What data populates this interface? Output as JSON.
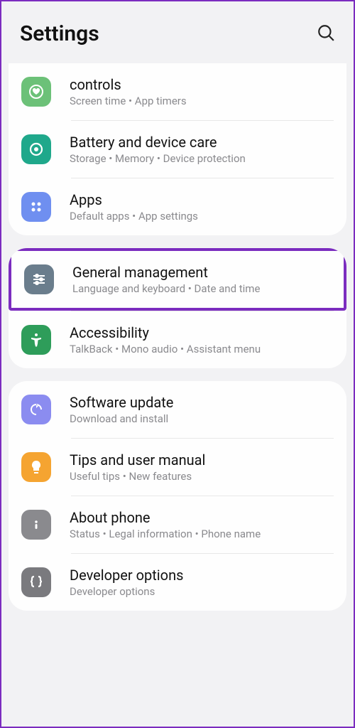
{
  "header": {
    "title": "Settings"
  },
  "groups": [
    {
      "items": [
        {
          "id": "controls",
          "title": "controls",
          "subtitle": "Screen time  •  App timers",
          "iconColor": "#6cc178",
          "iconName": "heart-circle-icon"
        },
        {
          "id": "battery",
          "title": "Battery and device care",
          "subtitle": "Storage  •  Memory  •  Device protection",
          "iconColor": "#1fa88b",
          "iconName": "battery-care-icon"
        },
        {
          "id": "apps",
          "title": "Apps",
          "subtitle": "Default apps  •  App settings",
          "iconColor": "#6f8ff0",
          "iconName": "apps-grid-icon"
        }
      ]
    },
    {
      "items": [
        {
          "id": "general",
          "title": "General management",
          "subtitle": "Language and keyboard  •  Date and time",
          "iconColor": "#6a7d8c",
          "iconName": "sliders-icon",
          "highlighted": true
        },
        {
          "id": "accessibility",
          "title": "Accessibility",
          "subtitle": "TalkBack  •  Mono audio  •  Assistant menu",
          "iconColor": "#2e9d5a",
          "iconName": "accessibility-icon"
        }
      ]
    },
    {
      "items": [
        {
          "id": "software",
          "title": "Software update",
          "subtitle": "Download and install",
          "iconColor": "#8b8cf0",
          "iconName": "update-icon"
        },
        {
          "id": "tips",
          "title": "Tips and user manual",
          "subtitle": "Useful tips  •  New features",
          "iconColor": "#f5a431",
          "iconName": "lightbulb-icon"
        },
        {
          "id": "about",
          "title": "About phone",
          "subtitle": "Status  •  Legal information  •  Phone name",
          "iconColor": "#8a8a8e",
          "iconName": "info-icon"
        },
        {
          "id": "developer",
          "title": "Developer options",
          "subtitle": "Developer options",
          "iconColor": "#7a7a7e",
          "iconName": "braces-icon"
        }
      ]
    }
  ]
}
